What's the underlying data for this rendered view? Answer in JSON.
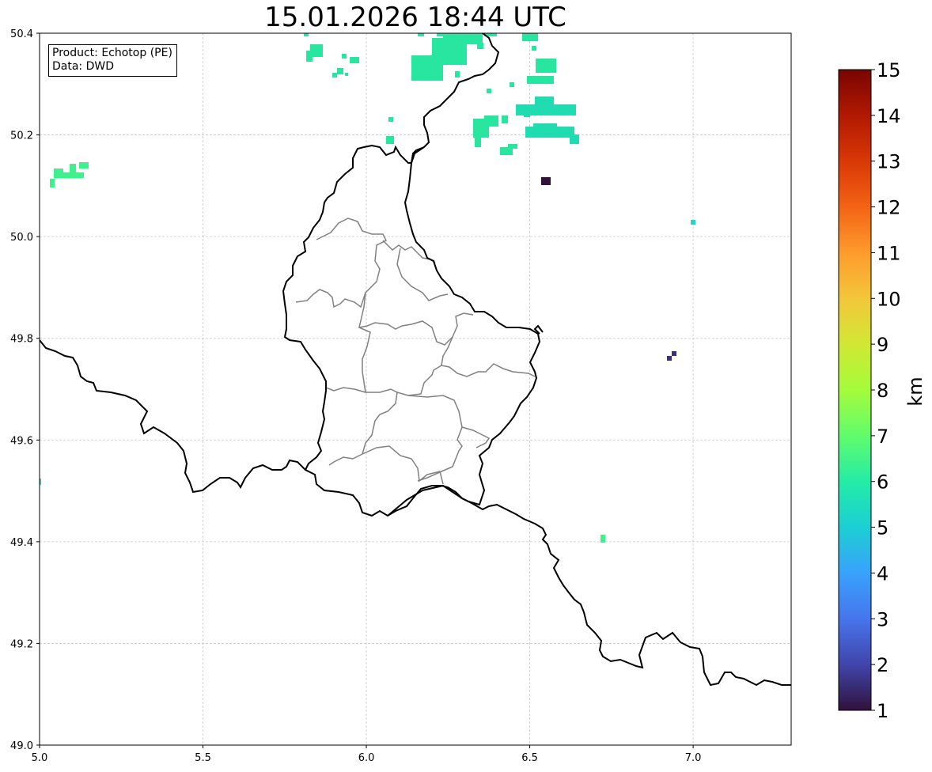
{
  "title": "15.01.2026 18:44 UTC",
  "info": {
    "product": "Product: Echotop (PE)",
    "data": "Data: DWD"
  },
  "map": {
    "lon_range": [
      5.0,
      7.3
    ],
    "lat_range": [
      49.0,
      50.4
    ],
    "x_ticks": [
      "5.0",
      "5.5",
      "6.0",
      "6.5",
      "7.0"
    ],
    "y_ticks": [
      "49.0",
      "49.2",
      "49.4",
      "49.6",
      "49.8",
      "50.0",
      "50.2",
      "50.4"
    ],
    "grid": true,
    "border_color": "#000000",
    "canton_color": "#808080"
  },
  "colorbar": {
    "label": "km",
    "min": 1,
    "max": 15,
    "ticks": [
      "1",
      "2",
      "3",
      "4",
      "5",
      "6",
      "7",
      "8",
      "9",
      "10",
      "11",
      "12",
      "13",
      "14",
      "15"
    ],
    "colormap": "turbo",
    "stops": [
      "#30123b",
      "#4145ab",
      "#4675ed",
      "#39a2fc",
      "#1bcfd4",
      "#24eca6",
      "#61fc6c",
      "#a4fc3b",
      "#d1e834",
      "#f3c63a",
      "#fe9b2d",
      "#f36315",
      "#d93806",
      "#b11901",
      "#7a0402"
    ]
  },
  "echo_cells": [
    {
      "lon": 5.03,
      "lat": 50.12,
      "km": 6.8
    },
    {
      "lon": 5.1,
      "lat": 50.14,
      "km": 6.8
    },
    {
      "lon": 5.85,
      "lat": 50.36,
      "km": 5.9
    },
    {
      "lon": 5.92,
      "lat": 50.32,
      "km": 5.9
    },
    {
      "lon": 5.96,
      "lat": 50.35,
      "km": 5.9
    },
    {
      "lon": 6.07,
      "lat": 50.2,
      "km": 5.9
    },
    {
      "lon": 6.24,
      "lat": 50.35,
      "km": 5.9
    },
    {
      "lon": 6.37,
      "lat": 50.21,
      "km": 5.9
    },
    {
      "lon": 6.54,
      "lat": 50.34,
      "km": 5.9
    },
    {
      "lon": 6.58,
      "lat": 50.26,
      "km": 5.6
    },
    {
      "lon": 6.6,
      "lat": 50.2,
      "km": 5.6
    },
    {
      "lon": 6.55,
      "lat": 50.11,
      "km": 1.0
    },
    {
      "lon": 7.0,
      "lat": 50.03,
      "km": 5.6
    },
    {
      "lon": 6.94,
      "lat": 49.77,
      "km": 1.6
    },
    {
      "lon": 6.72,
      "lat": 49.41,
      "km": 6.0
    },
    {
      "lon": 5.0,
      "lat": 49.52,
      "km": 5.9
    }
  ]
}
